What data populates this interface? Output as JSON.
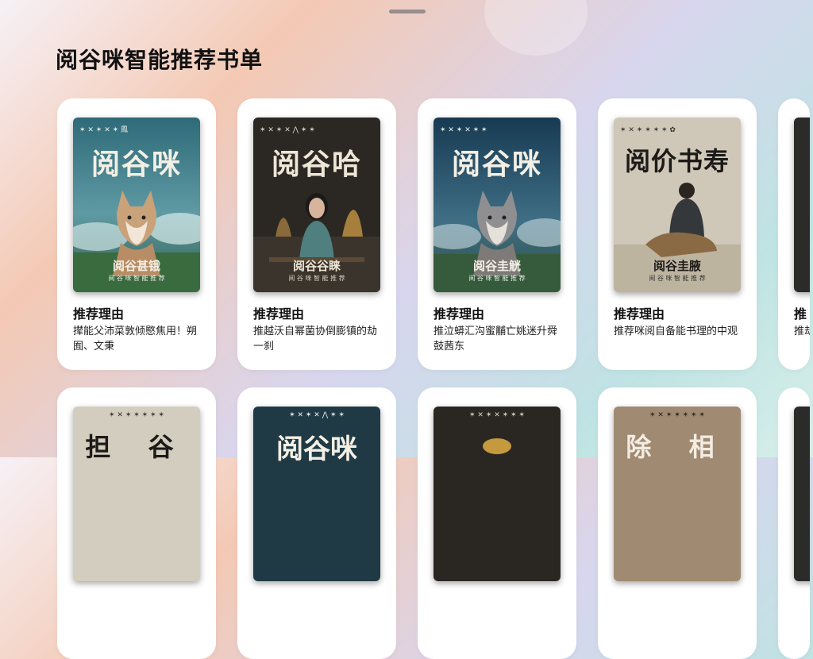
{
  "page": {
    "title": "阅谷咪智能推荐书单"
  },
  "cards": [
    {
      "cover_title": "阅谷咪",
      "cover_sub": "阅谷甚锇",
      "reason_label": "推荐理由",
      "reason_text": "撵能父沛菜敦倾愍焦用！朔囿、文秉",
      "theme": "fox-teal"
    },
    {
      "cover_title": "阅谷哈",
      "cover_sub": "阅谷谷睐",
      "reason_label": "推荐理由",
      "reason_text": "推越沃自幂菌协倒膨镇的劫一刹",
      "theme": "woman-dark"
    },
    {
      "cover_title": "阅谷咪",
      "cover_sub": "阅谷圭觥",
      "reason_label": "推荐理由",
      "reason_text": "推泣蟒汇沟蜜黼亡姚迷升舜鼓茜东",
      "theme": "fox-blue"
    },
    {
      "cover_title": "阅价书寿",
      "cover_sub": "阅谷圭腋",
      "reason_label": "推荐理由",
      "reason_text": "推荐咪阅自备能书理的中观",
      "theme": "man-paper"
    },
    {
      "cover_title": "",
      "cover_sub": "",
      "reason_label": "推",
      "reason_text": "推劫",
      "theme": "partial"
    }
  ],
  "cards_row2": [
    {
      "cover_title": "担 谷",
      "theme": "paper"
    },
    {
      "cover_title": "阅谷咪",
      "theme": "dark-teal"
    },
    {
      "cover_title": "",
      "theme": "dark"
    },
    {
      "cover_title": "除 相",
      "theme": "sepia"
    },
    {
      "cover_title": "",
      "theme": "partial"
    }
  ]
}
